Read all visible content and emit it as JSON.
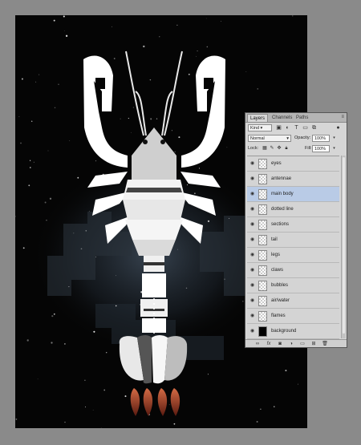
{
  "panel": {
    "tabs": [
      "Layers",
      "Channels",
      "Paths"
    ],
    "active_tab": "Layers",
    "panel_menu_icon": "panel-menu-icon",
    "filter_kind": "Kind",
    "filter_icons": [
      "pixel-filter-icon",
      "adjustment-filter-icon",
      "type-filter-icon",
      "shape-filter-icon",
      "smart-object-filter-icon",
      "filter-toggle-icon"
    ],
    "blend_mode": "Normal",
    "opacity_label": "Opacity:",
    "opacity_value": "100%",
    "lock_label": "Lock:",
    "fill_label": "Fill:",
    "fill_value": "100%",
    "layers": [
      {
        "name": "eyes",
        "selected": false
      },
      {
        "name": "antennae",
        "selected": false
      },
      {
        "name": "main body",
        "selected": true
      },
      {
        "name": "dotted line",
        "selected": false
      },
      {
        "name": "sections",
        "selected": false
      },
      {
        "name": "tail",
        "selected": false
      },
      {
        "name": "legs",
        "selected": false
      },
      {
        "name": "claws",
        "selected": false
      },
      {
        "name": "bubbles",
        "selected": false
      },
      {
        "name": "air/water",
        "selected": false
      },
      {
        "name": "flames",
        "selected": false
      },
      {
        "name": "background",
        "selected": false
      }
    ],
    "bottom_icons": [
      "link-layers-icon",
      "fx-icon",
      "add-mask-icon",
      "adjustment-layer-icon",
      "new-group-icon",
      "new-layer-icon",
      "delete-layer-icon"
    ]
  },
  "colors": {
    "canvas_background": "#050505",
    "panel_background": "#d6d6d6",
    "selection_highlight": "#b9cbe6",
    "workspace_gray": "#8a8a8a",
    "flame_color": "#a0391f"
  }
}
